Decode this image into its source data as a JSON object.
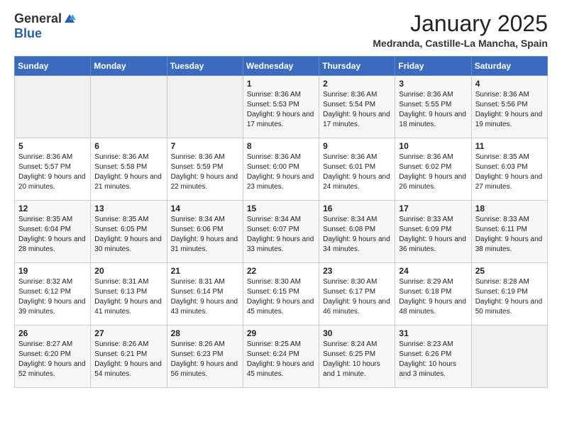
{
  "header": {
    "logo_general": "General",
    "logo_blue": "Blue",
    "month_title": "January 2025",
    "location": "Medranda, Castille-La Mancha, Spain"
  },
  "days_of_week": [
    "Sunday",
    "Monday",
    "Tuesday",
    "Wednesday",
    "Thursday",
    "Friday",
    "Saturday"
  ],
  "weeks": [
    [
      {
        "day": "",
        "content": ""
      },
      {
        "day": "",
        "content": ""
      },
      {
        "day": "",
        "content": ""
      },
      {
        "day": "1",
        "content": "Sunrise: 8:36 AM\nSunset: 5:53 PM\nDaylight: 9 hours and 17 minutes."
      },
      {
        "day": "2",
        "content": "Sunrise: 8:36 AM\nSunset: 5:54 PM\nDaylight: 9 hours and 17 minutes."
      },
      {
        "day": "3",
        "content": "Sunrise: 8:36 AM\nSunset: 5:55 PM\nDaylight: 9 hours and 18 minutes."
      },
      {
        "day": "4",
        "content": "Sunrise: 8:36 AM\nSunset: 5:56 PM\nDaylight: 9 hours and 19 minutes."
      }
    ],
    [
      {
        "day": "5",
        "content": "Sunrise: 8:36 AM\nSunset: 5:57 PM\nDaylight: 9 hours and 20 minutes."
      },
      {
        "day": "6",
        "content": "Sunrise: 8:36 AM\nSunset: 5:58 PM\nDaylight: 9 hours and 21 minutes."
      },
      {
        "day": "7",
        "content": "Sunrise: 8:36 AM\nSunset: 5:59 PM\nDaylight: 9 hours and 22 minutes."
      },
      {
        "day": "8",
        "content": "Sunrise: 8:36 AM\nSunset: 6:00 PM\nDaylight: 9 hours and 23 minutes."
      },
      {
        "day": "9",
        "content": "Sunrise: 8:36 AM\nSunset: 6:01 PM\nDaylight: 9 hours and 24 minutes."
      },
      {
        "day": "10",
        "content": "Sunrise: 8:36 AM\nSunset: 6:02 PM\nDaylight: 9 hours and 26 minutes."
      },
      {
        "day": "11",
        "content": "Sunrise: 8:35 AM\nSunset: 6:03 PM\nDaylight: 9 hours and 27 minutes."
      }
    ],
    [
      {
        "day": "12",
        "content": "Sunrise: 8:35 AM\nSunset: 6:04 PM\nDaylight: 9 hours and 28 minutes."
      },
      {
        "day": "13",
        "content": "Sunrise: 8:35 AM\nSunset: 6:05 PM\nDaylight: 9 hours and 30 minutes."
      },
      {
        "day": "14",
        "content": "Sunrise: 8:34 AM\nSunset: 6:06 PM\nDaylight: 9 hours and 31 minutes."
      },
      {
        "day": "15",
        "content": "Sunrise: 8:34 AM\nSunset: 6:07 PM\nDaylight: 9 hours and 33 minutes."
      },
      {
        "day": "16",
        "content": "Sunrise: 8:34 AM\nSunset: 6:08 PM\nDaylight: 9 hours and 34 minutes."
      },
      {
        "day": "17",
        "content": "Sunrise: 8:33 AM\nSunset: 6:09 PM\nDaylight: 9 hours and 36 minutes."
      },
      {
        "day": "18",
        "content": "Sunrise: 8:33 AM\nSunset: 6:11 PM\nDaylight: 9 hours and 38 minutes."
      }
    ],
    [
      {
        "day": "19",
        "content": "Sunrise: 8:32 AM\nSunset: 6:12 PM\nDaylight: 9 hours and 39 minutes."
      },
      {
        "day": "20",
        "content": "Sunrise: 8:31 AM\nSunset: 6:13 PM\nDaylight: 9 hours and 41 minutes."
      },
      {
        "day": "21",
        "content": "Sunrise: 8:31 AM\nSunset: 6:14 PM\nDaylight: 9 hours and 43 minutes."
      },
      {
        "day": "22",
        "content": "Sunrise: 8:30 AM\nSunset: 6:15 PM\nDaylight: 9 hours and 45 minutes."
      },
      {
        "day": "23",
        "content": "Sunrise: 8:30 AM\nSunset: 6:17 PM\nDaylight: 9 hours and 46 minutes."
      },
      {
        "day": "24",
        "content": "Sunrise: 8:29 AM\nSunset: 6:18 PM\nDaylight: 9 hours and 48 minutes."
      },
      {
        "day": "25",
        "content": "Sunrise: 8:28 AM\nSunset: 6:19 PM\nDaylight: 9 hours and 50 minutes."
      }
    ],
    [
      {
        "day": "26",
        "content": "Sunrise: 8:27 AM\nSunset: 6:20 PM\nDaylight: 9 hours and 52 minutes."
      },
      {
        "day": "27",
        "content": "Sunrise: 8:26 AM\nSunset: 6:21 PM\nDaylight: 9 hours and 54 minutes."
      },
      {
        "day": "28",
        "content": "Sunrise: 8:26 AM\nSunset: 6:23 PM\nDaylight: 9 hours and 56 minutes."
      },
      {
        "day": "29",
        "content": "Sunrise: 8:25 AM\nSunset: 6:24 PM\nDaylight: 9 hours and 45 minutes."
      },
      {
        "day": "30",
        "content": "Sunrise: 8:24 AM\nSunset: 6:25 PM\nDaylight: 10 hours and 1 minute."
      },
      {
        "day": "31",
        "content": "Sunrise: 8:23 AM\nSunset: 6:26 PM\nDaylight: 10 hours and 3 minutes."
      },
      {
        "day": "",
        "content": ""
      }
    ]
  ]
}
